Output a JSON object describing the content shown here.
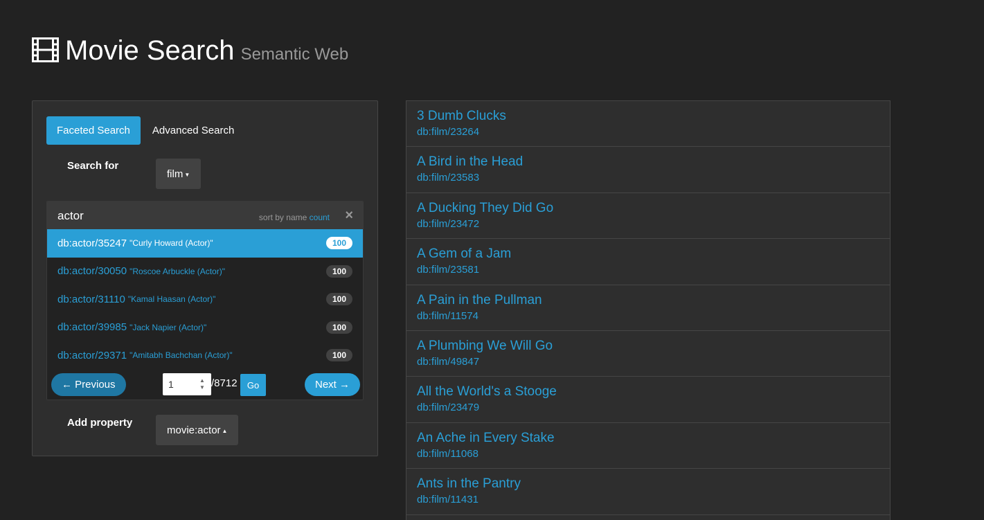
{
  "header": {
    "title": "Movie Search",
    "subtitle": "Semantic Web",
    "icon": "film-icon"
  },
  "tabs": [
    {
      "label": "Faceted Search",
      "active": true
    },
    {
      "label": "Advanced Search",
      "active": false
    }
  ],
  "search_for": {
    "label": "Search for",
    "selected": "film"
  },
  "facet": {
    "title": "actor",
    "sort_prefix": "sort by",
    "sort_name": "name",
    "sort_count": "count",
    "close": "×",
    "items": [
      {
        "id": "db:actor/35247",
        "name": "\"Curly Howard (Actor)\"",
        "count": "100",
        "active": true
      },
      {
        "id": "db:actor/30050",
        "name": "\"Roscoe Arbuckle (Actor)\"",
        "count": "100",
        "active": false
      },
      {
        "id": "db:actor/31110",
        "name": "\"Kamal Haasan (Actor)\"",
        "count": "100",
        "active": false
      },
      {
        "id": "db:actor/39985",
        "name": "\"Jack Napier (Actor)\"",
        "count": "100",
        "active": false
      },
      {
        "id": "db:actor/29371",
        "name": "\"Amitabh Bachchan (Actor)\"",
        "count": "100",
        "active": false
      }
    ]
  },
  "pager": {
    "previous": "← Previous",
    "next": "Next →",
    "page": "1",
    "total": "/8712",
    "go": "Go"
  },
  "add_property": {
    "label": "Add property",
    "selected": "movie:actor"
  },
  "results": [
    {
      "title": "3 Dumb Clucks",
      "id": "db:film/23264"
    },
    {
      "title": "A Bird in the Head",
      "id": "db:film/23583"
    },
    {
      "title": "A Ducking They Did Go",
      "id": "db:film/23472"
    },
    {
      "title": "A Gem of a Jam",
      "id": "db:film/23581"
    },
    {
      "title": "A Pain in the Pullman",
      "id": "db:film/11574"
    },
    {
      "title": "A Plumbing We Will Go",
      "id": "db:film/49847"
    },
    {
      "title": "All the World's a Stooge",
      "id": "db:film/23479"
    },
    {
      "title": "An Ache in Every Stake",
      "id": "db:film/11068"
    },
    {
      "title": "Ants in the Pantry",
      "id": "db:film/11431"
    }
  ],
  "colors": {
    "accent": "#2a9fd6",
    "background": "#222222",
    "panel": "#2e2e2e"
  }
}
